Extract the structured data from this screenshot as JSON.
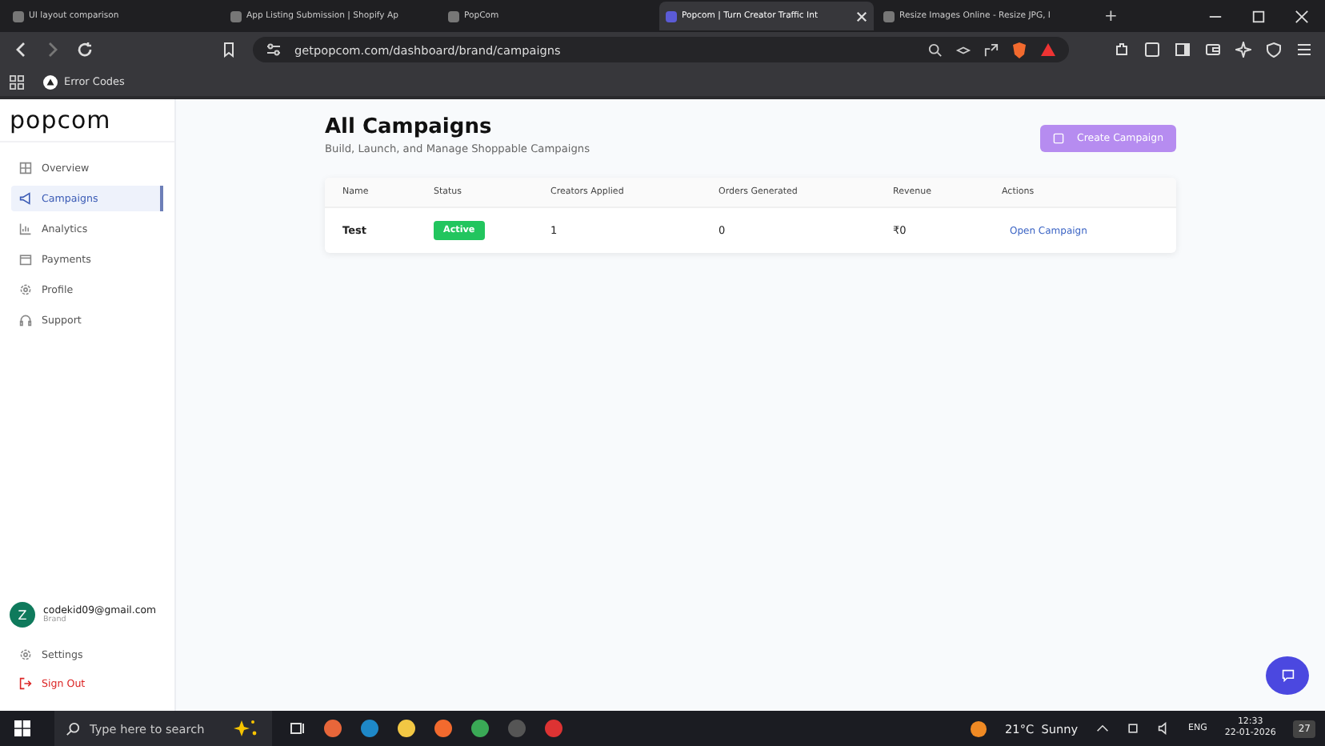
{
  "browser": {
    "tabs": [
      {
        "title": "UI layout comparison",
        "selected": false
      },
      {
        "title": "App Listing Submission | Shopify Ap",
        "selected": false
      },
      {
        "title": "PopCom",
        "selected": false
      },
      {
        "title": "Popcom | Turn Creator Traffic Int",
        "selected": true
      },
      {
        "title": "Resize Images Online - Resize JPG, I",
        "selected": false
      }
    ],
    "new_tab": "+",
    "url": "getpopcom.com/dashboard/brand/campaigns",
    "bookmarks": [
      "Error Codes"
    ]
  },
  "sidebar": {
    "logo": "popcom",
    "nav": [
      {
        "label": "Overview",
        "selected": false
      },
      {
        "label": "Campaigns",
        "selected": true
      },
      {
        "label": "Analytics",
        "selected": false
      },
      {
        "label": "Payments",
        "selected": false
      },
      {
        "label": "Profile",
        "selected": false
      },
      {
        "label": "Support",
        "selected": false
      }
    ],
    "user": {
      "initial": "Z",
      "email": "codekid09@gmail.com",
      "role": "Brand"
    },
    "footer": [
      {
        "label": "Settings",
        "kind": "settings"
      },
      {
        "label": "Sign Out",
        "kind": "signout"
      }
    ]
  },
  "main": {
    "title": "All Campaigns",
    "subtitle": "Build, Launch, and Manage Shoppable Campaigns",
    "create_button": "Create Campaign",
    "table": {
      "columns": [
        "Name",
        "Status",
        "Creators Applied",
        "Orders Generated",
        "Revenue",
        "Actions"
      ],
      "rows": [
        {
          "name": "Test",
          "status": "Active",
          "creators": "1",
          "orders": "0",
          "revenue": "₹0",
          "action": "Open Campaign"
        }
      ]
    }
  },
  "taskbar": {
    "search_placeholder": "Type here to search",
    "weather": "21°C  Sunny",
    "language": "ENG",
    "time": "12:33",
    "date": "22-01-2026",
    "notifications": "27"
  }
}
